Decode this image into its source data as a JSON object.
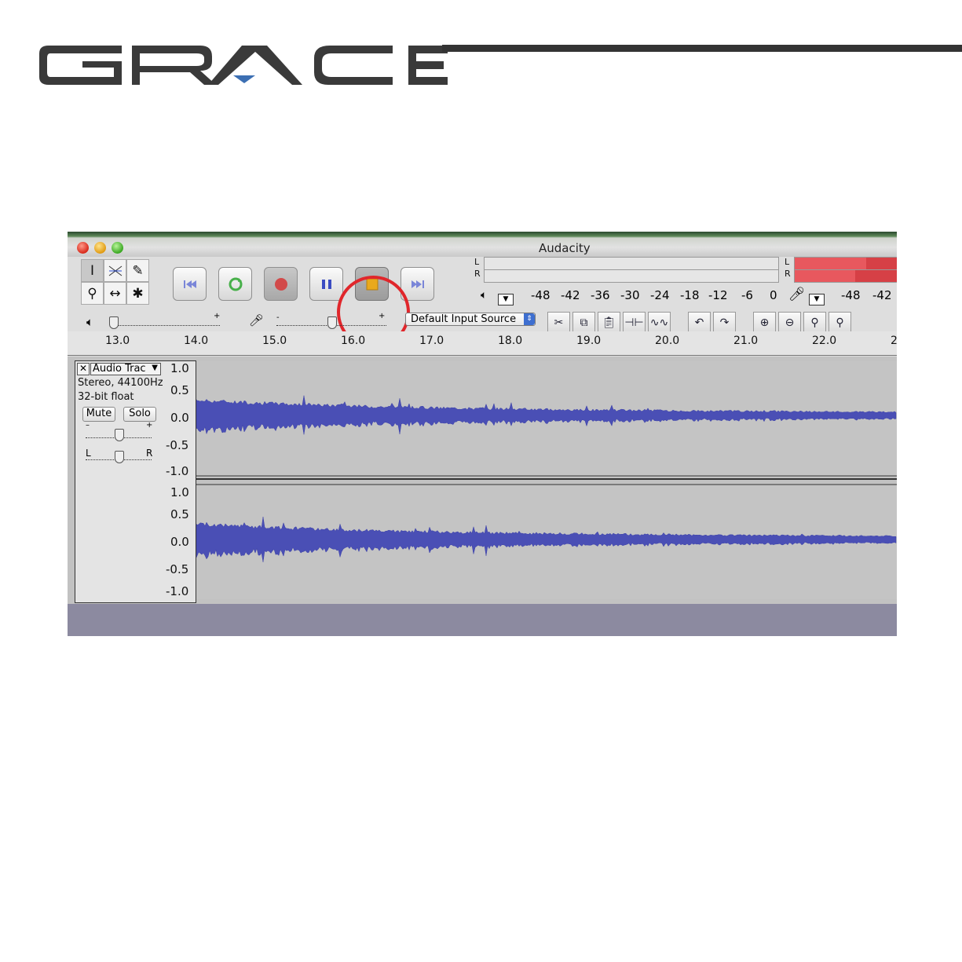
{
  "logo": {
    "text": "GRACE"
  },
  "window": {
    "title": "Audacity",
    "tools": [
      "selection-tool",
      "envelope-tool",
      "draw-tool",
      "zoom-tool",
      "timeshift-tool",
      "multi-tool"
    ],
    "transport": [
      "skip-start",
      "play",
      "record",
      "pause",
      "stop",
      "skip-end"
    ],
    "meters": {
      "left_channel": "L",
      "right_channel": "R",
      "playback_scale": [
        "-48",
        "-42",
        "-36",
        "-30",
        "-24",
        "-18",
        "-12",
        "-6",
        "0"
      ],
      "record_scale": [
        "-48",
        "-42"
      ]
    },
    "input_source": "Default Input Source",
    "ruler": [
      "13.0",
      "14.0",
      "15.0",
      "16.0",
      "17.0",
      "18.0",
      "19.0",
      "20.0",
      "21.0",
      "22.0",
      "2"
    ],
    "track": {
      "name": "Audio Trac",
      "format": "Stereo, 44100Hz",
      "bit_depth": "32-bit float",
      "mute_label": "Mute",
      "solo_label": "Solo",
      "gain_minus": "–",
      "gain_plus": "+",
      "pan_left": "L",
      "pan_right": "R"
    },
    "amplitude_scale": [
      "1.0",
      "0.5",
      "0.0",
      "-0.5",
      "-1.0"
    ],
    "colors": {
      "waveform": "#4a4fb5",
      "highlight_circle": "#e0262b",
      "meter_red": "#e8585e"
    }
  }
}
